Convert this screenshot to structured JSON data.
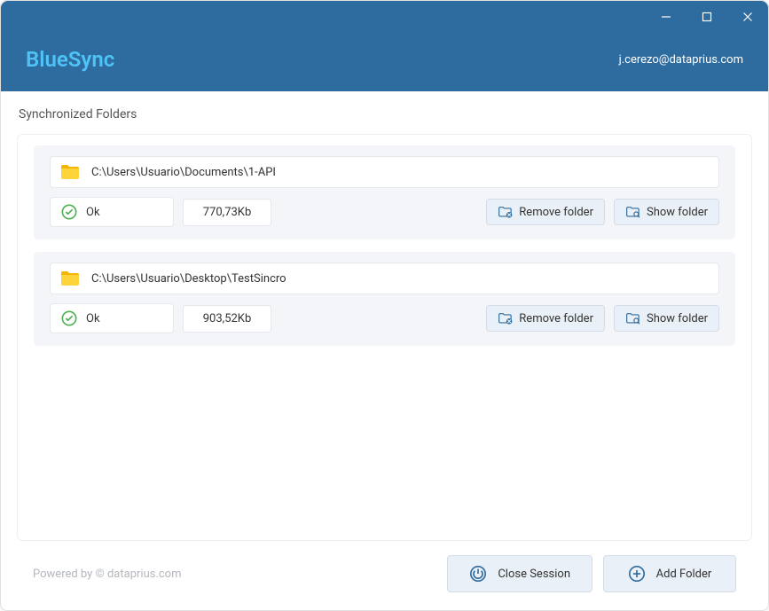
{
  "app": {
    "name": "BlueSync",
    "user_email": "j.cerezo@dataprius.com"
  },
  "section_title": "Synchronized Folders",
  "folders": [
    {
      "path": "C:\\Users\\Usuario\\Documents\\1-API",
      "status": "Ok",
      "size": "770,73Kb"
    },
    {
      "path": "C:\\Users\\Usuario\\Desktop\\TestSincro",
      "status": "Ok",
      "size": "903,52Kb"
    }
  ],
  "buttons": {
    "remove_folder": "Remove folder",
    "show_folder": "Show folder",
    "close_session": "Close Session",
    "add_folder": "Add Folder"
  },
  "footer": {
    "powered_by": "Powered by © dataprius.com"
  },
  "colors": {
    "header_bg": "#2e6b9e",
    "logo_color": "#4fc3f7",
    "card_bg": "#f3f5f8",
    "btn_bg": "#eaf0f7"
  }
}
